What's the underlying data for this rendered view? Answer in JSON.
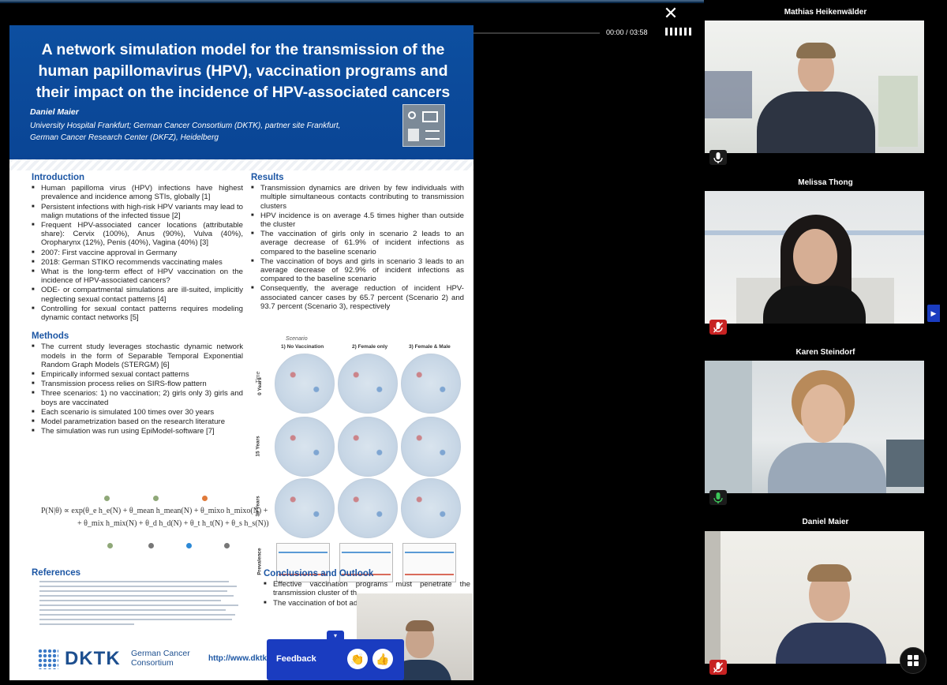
{
  "player": {
    "close_label": "✕",
    "timecode": "00:00 / 03:58"
  },
  "poster": {
    "title": "A network simulation model for the transmission of the human papillomavirus (HPV), vaccination programs and their impact on the incidence of HPV-associated cancers",
    "author": "Daniel Maier",
    "affiliation_1": "University Hospital Frankfurt; German Cancer Consortium (DKTK), partner site Frankfurt,",
    "affiliation_2": "German Cancer Research Center (DKFZ), Heidelberg",
    "introduction": {
      "heading": "Introduction",
      "items": [
        "Human papilloma virus (HPV) infections have highest prevalence and incidence among STIs, globally [1]",
        "Persistent infections with high-risk HPV variants may lead to malign mutations of the infected tissue [2]",
        "Frequent HPV-associated cancer locations (attributable share): Cervix (100%), Anus (90%), Vulva (40%), Oropharynx (12%), Penis (40%), Vagina (40%) [3]",
        "2007: First vaccine approval in Germany",
        "2018: German STIKO recommends vaccinating males",
        "What is the long-term effect of HPV vaccination on the incidence of HPV-associated cancers?",
        "ODE- or compartmental simulations are ill-suited, implicitly neglecting sexual contact patterns [4]",
        "Controlling for sexual contact patterns requires modeling dynamic contact networks [5]"
      ]
    },
    "methods": {
      "heading": "Methods",
      "items": [
        "The current study leverages stochastic dynamic network models in the form of Separable Temporal Exponential Random Graph Models (STERGM) [6]",
        "Empirically informed sexual contact patterns",
        "Transmission process relies on SIRS-flow pattern",
        "Three scenarios: 1) no vaccination; 2) girls only 3) girls and boys are vaccinated",
        "Each scenario is simulated 100 times over 30 years",
        "Model parametrization based on the research literature",
        "The simulation was run using EpiModel-software [7]"
      ]
    },
    "formula": {
      "line1": "P(N|θ) ∝ exp(θ_e h_e(N) + θ_mean h_mean(N) + θ_mixo h_mixo(N) +",
      "line2": "+ θ_mix h_mix(N) + θ_d h_d(N) + θ_t h_t(N) + θ_s h_s(N))"
    },
    "references": {
      "heading": "References"
    },
    "results": {
      "heading": "Results",
      "items": [
        "Transmission dynamics are driven by few individuals with multiple simultaneous contacts contributing to transmission clusters",
        "HPV incidence is on average 4.5 times higher than outside the cluster",
        "The vaccination of girls only in scenario 2 leads to an average decrease of 61.9% of incident infections as compared to the baseline scenario",
        "The vaccination of boys and girls in scenario 3 leads to an average decrease of 92.9% of incident infections as compared to the baseline scenario",
        "Consequently, the average reduction of incident HPV-associated cancer cases by 65.7 percent (Scenario 2) and 93.7 percent (Scenario 3), respectively"
      ]
    },
    "figure": {
      "scenario_label": "Scenario",
      "time_label": "Time",
      "columns": [
        "1) No Vaccination",
        "2) Female only",
        "3) Female & Male"
      ],
      "rows": [
        "0 Years",
        "15 Years",
        "30 Years"
      ],
      "prevalence_label": "Prevalence"
    },
    "conclusions": {
      "heading": "Conclusions and Outlook",
      "items": [
        "Effective vaccination programs must penetrate the transmission cluster of th",
        "The vaccination of bot additional benefit for the cancers"
      ]
    },
    "logo_name": "DKTK",
    "logo_sub_1": "German Cancer",
    "logo_sub_2": "Consortium",
    "url": "http://www.dktk."
  },
  "feedback": {
    "label": "Feedback",
    "clap_icon": "👏",
    "thumb_icon": "👍"
  },
  "participants": [
    {
      "name": "Mathias Heikenwälder",
      "mic": "on"
    },
    {
      "name": "Melissa Thong",
      "mic": "muted"
    },
    {
      "name": "Karen Steindorf",
      "mic": "speaking"
    },
    {
      "name": "Daniel Maier",
      "mic": "muted"
    }
  ]
}
